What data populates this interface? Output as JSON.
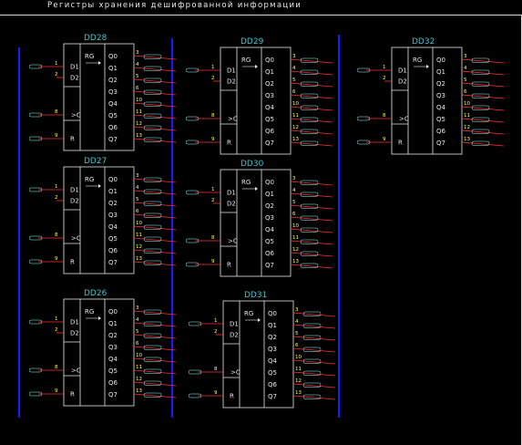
{
  "title": "Регистры хранения дешифрованной информации",
  "chips": [
    {
      "ref": "DD28",
      "rg": "RG",
      "pins_in": [
        "D1",
        "D2",
        "C",
        "R"
      ],
      "pin_nums_in": [
        "1",
        "2",
        "8",
        "9"
      ],
      "outputs": [
        "Q0",
        "Q1",
        "Q2",
        "Q3",
        "Q4",
        "Q5",
        "Q6",
        "Q7"
      ],
      "out_nums": [
        "3",
        "4",
        "5",
        "6",
        "10",
        "11",
        "12",
        "13"
      ]
    },
    {
      "ref": "DD29",
      "rg": "RG",
      "pins_in": [
        "D1",
        "D2",
        "C",
        "R"
      ],
      "pin_nums_in": [
        "1",
        "2",
        "8",
        "9"
      ],
      "outputs": [
        "Q0",
        "Q1",
        "Q2",
        "Q3",
        "Q4",
        "Q5",
        "Q6",
        "Q7"
      ],
      "out_nums": [
        "3",
        "4",
        "5",
        "6",
        "10",
        "11",
        "12",
        "13"
      ]
    },
    {
      "ref": "DD32",
      "rg": "RG",
      "pins_in": [
        "D1",
        "D2",
        "C",
        "R"
      ],
      "pin_nums_in": [
        "1",
        "2",
        "8",
        "9"
      ],
      "outputs": [
        "Q0",
        "Q1",
        "Q2",
        "Q3",
        "Q4",
        "Q5",
        "Q6",
        "Q7"
      ],
      "out_nums": [
        "3",
        "4",
        "5",
        "6",
        "10",
        "11",
        "12",
        "13"
      ]
    },
    {
      "ref": "DD27",
      "rg": "RG",
      "pins_in": [
        "D1",
        "D2",
        "C",
        "R"
      ],
      "pin_nums_in": [
        "1",
        "2",
        "8",
        "9"
      ],
      "outputs": [
        "Q0",
        "Q1",
        "Q2",
        "Q3",
        "Q4",
        "Q5",
        "Q6",
        "Q7"
      ],
      "out_nums": [
        "3",
        "4",
        "5",
        "6",
        "10",
        "11",
        "12",
        "13"
      ]
    },
    {
      "ref": "DD30",
      "rg": "RG",
      "pins_in": [
        "D1",
        "D2",
        "C",
        "R"
      ],
      "pin_nums_in": [
        "1",
        "2",
        "8",
        "9"
      ],
      "outputs": [
        "Q0",
        "Q1",
        "Q2",
        "Q3",
        "Q4",
        "Q5",
        "Q6",
        "Q7"
      ],
      "out_nums": [
        "3",
        "4",
        "5",
        "6",
        "10",
        "11",
        "12",
        "13"
      ]
    },
    {
      "ref": "DD26",
      "rg": "RG",
      "pins_in": [
        "D1",
        "D2",
        "C",
        "R"
      ],
      "pin_nums_in": [
        "1",
        "2",
        "8",
        "9"
      ],
      "outputs": [
        "Q0",
        "Q1",
        "Q2",
        "Q3",
        "Q4",
        "Q5",
        "Q6",
        "Q7"
      ],
      "out_nums": [
        "3",
        "4",
        "5",
        "6",
        "10",
        "11",
        "12",
        "13"
      ]
    },
    {
      "ref": "DD31",
      "rg": "RG",
      "pins_in": [
        "D1",
        "D2",
        "C",
        "R"
      ],
      "pin_nums_in": [
        "1",
        "2",
        "8",
        "9"
      ],
      "outputs": [
        "Q0",
        "Q1",
        "Q2",
        "Q3",
        "Q4",
        "Q5",
        "Q6",
        "Q7"
      ],
      "out_nums": [
        "3",
        "4",
        "5",
        "6",
        "10",
        "11",
        "12",
        "13"
      ]
    }
  ],
  "colors": {
    "background": "#000000",
    "bus": "#1a1aff",
    "wire": "#ff3030",
    "body": "#e8e8e8",
    "ref": "#4fc0c8",
    "pin_number": "#ffff55"
  }
}
